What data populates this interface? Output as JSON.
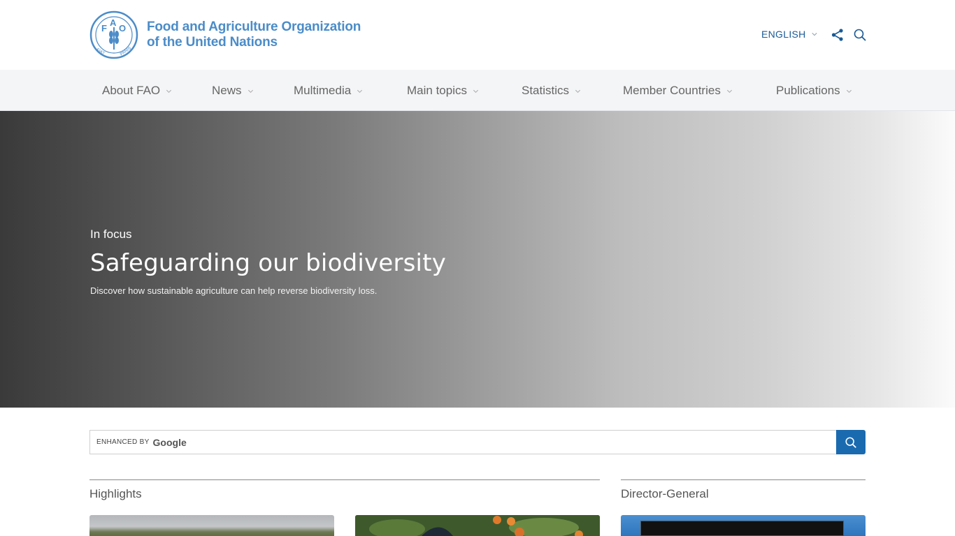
{
  "header": {
    "logo_line1": "Food and Agriculture Organization",
    "logo_line2": "of the United Nations",
    "logo_emblem_text": "FAO FIAT PANIS",
    "language": "ENGLISH",
    "brand_color": "#4b8cc8"
  },
  "nav": {
    "items": [
      {
        "label": "About FAO"
      },
      {
        "label": "News"
      },
      {
        "label": "Multimedia"
      },
      {
        "label": "Main topics"
      },
      {
        "label": "Statistics"
      },
      {
        "label": "Member Countries"
      },
      {
        "label": "Publications"
      }
    ]
  },
  "hero": {
    "kicker": "In focus",
    "title": "Safeguarding our biodiversity",
    "description": "Discover how sustainable agriculture can help reverse biodiversity loss."
  },
  "search": {
    "enhanced_label": "ENHANCED BY",
    "google_label": "Google",
    "button_color": "#1a6ab0"
  },
  "sections": {
    "highlights_title": "Highlights",
    "director_general_title": "Director-General"
  },
  "icons": {
    "share": "share-icon",
    "search": "search-icon",
    "chevron": "chevron-down-icon"
  }
}
